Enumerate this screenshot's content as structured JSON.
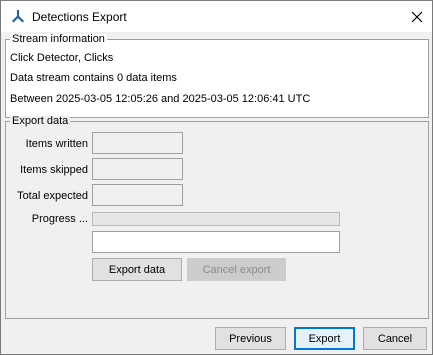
{
  "window": {
    "title": "Detections Export"
  },
  "icons": {
    "app": "app-icon",
    "close": "close-icon"
  },
  "stream": {
    "legend": "Stream information",
    "line1": "Click Detector, Clicks",
    "line2": "Data stream contains 0 data items",
    "line3": "Between 2025-03-05 12:05:26 and 2025-03-05 12:06:41 UTC"
  },
  "export": {
    "legend": "Export data",
    "items_written_label": "Items written",
    "items_written_value": "",
    "items_skipped_label": "Items skipped",
    "items_skipped_value": "",
    "total_expected_label": "Total expected",
    "total_expected_value": "",
    "progress_label": "Progress ...",
    "progress_value": 0,
    "status_value": "",
    "export_data_label": "Export data",
    "cancel_export_label": "Cancel export"
  },
  "footer": {
    "previous_label": "Previous",
    "export_label": "Export",
    "cancel_label": "Cancel"
  },
  "colors": {
    "accent": "#0078d7",
    "app_icon": "#1f5fa8"
  }
}
